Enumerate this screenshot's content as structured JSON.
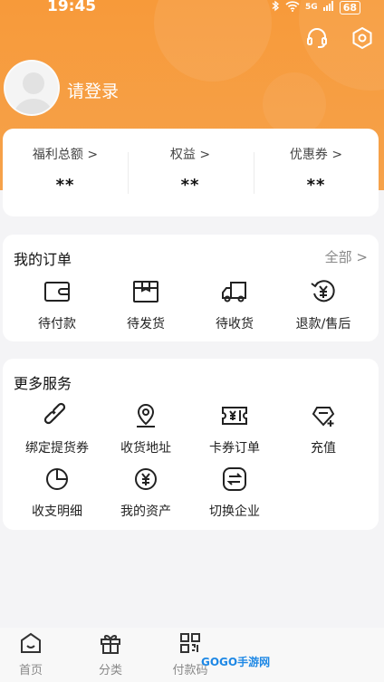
{
  "status_bar": {
    "time": "19:45",
    "network": "5G",
    "battery": "68"
  },
  "header": {
    "login_text": "请登录",
    "icons": [
      "headset-icon",
      "settings-icon"
    ]
  },
  "stats": [
    {
      "label": "福利总额 >",
      "value": "**"
    },
    {
      "label": "权益 >",
      "value": "**"
    },
    {
      "label": "优惠券 >",
      "value": "**"
    }
  ],
  "orders": {
    "title": "我的订单",
    "more": "全部 >",
    "items": [
      {
        "label": "待付款",
        "icon": "wallet-icon"
      },
      {
        "label": "待发货",
        "icon": "package-icon"
      },
      {
        "label": "待收货",
        "icon": "truck-icon"
      },
      {
        "label": "退款/售后",
        "icon": "refund-icon"
      }
    ]
  },
  "services": {
    "title": "更多服务",
    "items": [
      {
        "label": "绑定提货券",
        "icon": "link-icon"
      },
      {
        "label": "收货地址",
        "icon": "location-icon"
      },
      {
        "label": "卡券订单",
        "icon": "ticket-icon"
      },
      {
        "label": "充值",
        "icon": "recharge-icon"
      },
      {
        "label": "收支明细",
        "icon": "pie-chart-icon"
      },
      {
        "label": "我的资产",
        "icon": "yuan-icon"
      },
      {
        "label": "切换企业",
        "icon": "switch-icon"
      }
    ]
  },
  "bottom_nav": [
    {
      "label": "首页",
      "icon": "home-icon"
    },
    {
      "label": "分类",
      "icon": "gift-icon"
    },
    {
      "label": "付款码",
      "icon": "qr-code-icon"
    }
  ],
  "watermark": "GOGO手游网",
  "colors": {
    "accent": "#f79a3a",
    "card": "#ffffff",
    "background": "#f4f4f6"
  }
}
